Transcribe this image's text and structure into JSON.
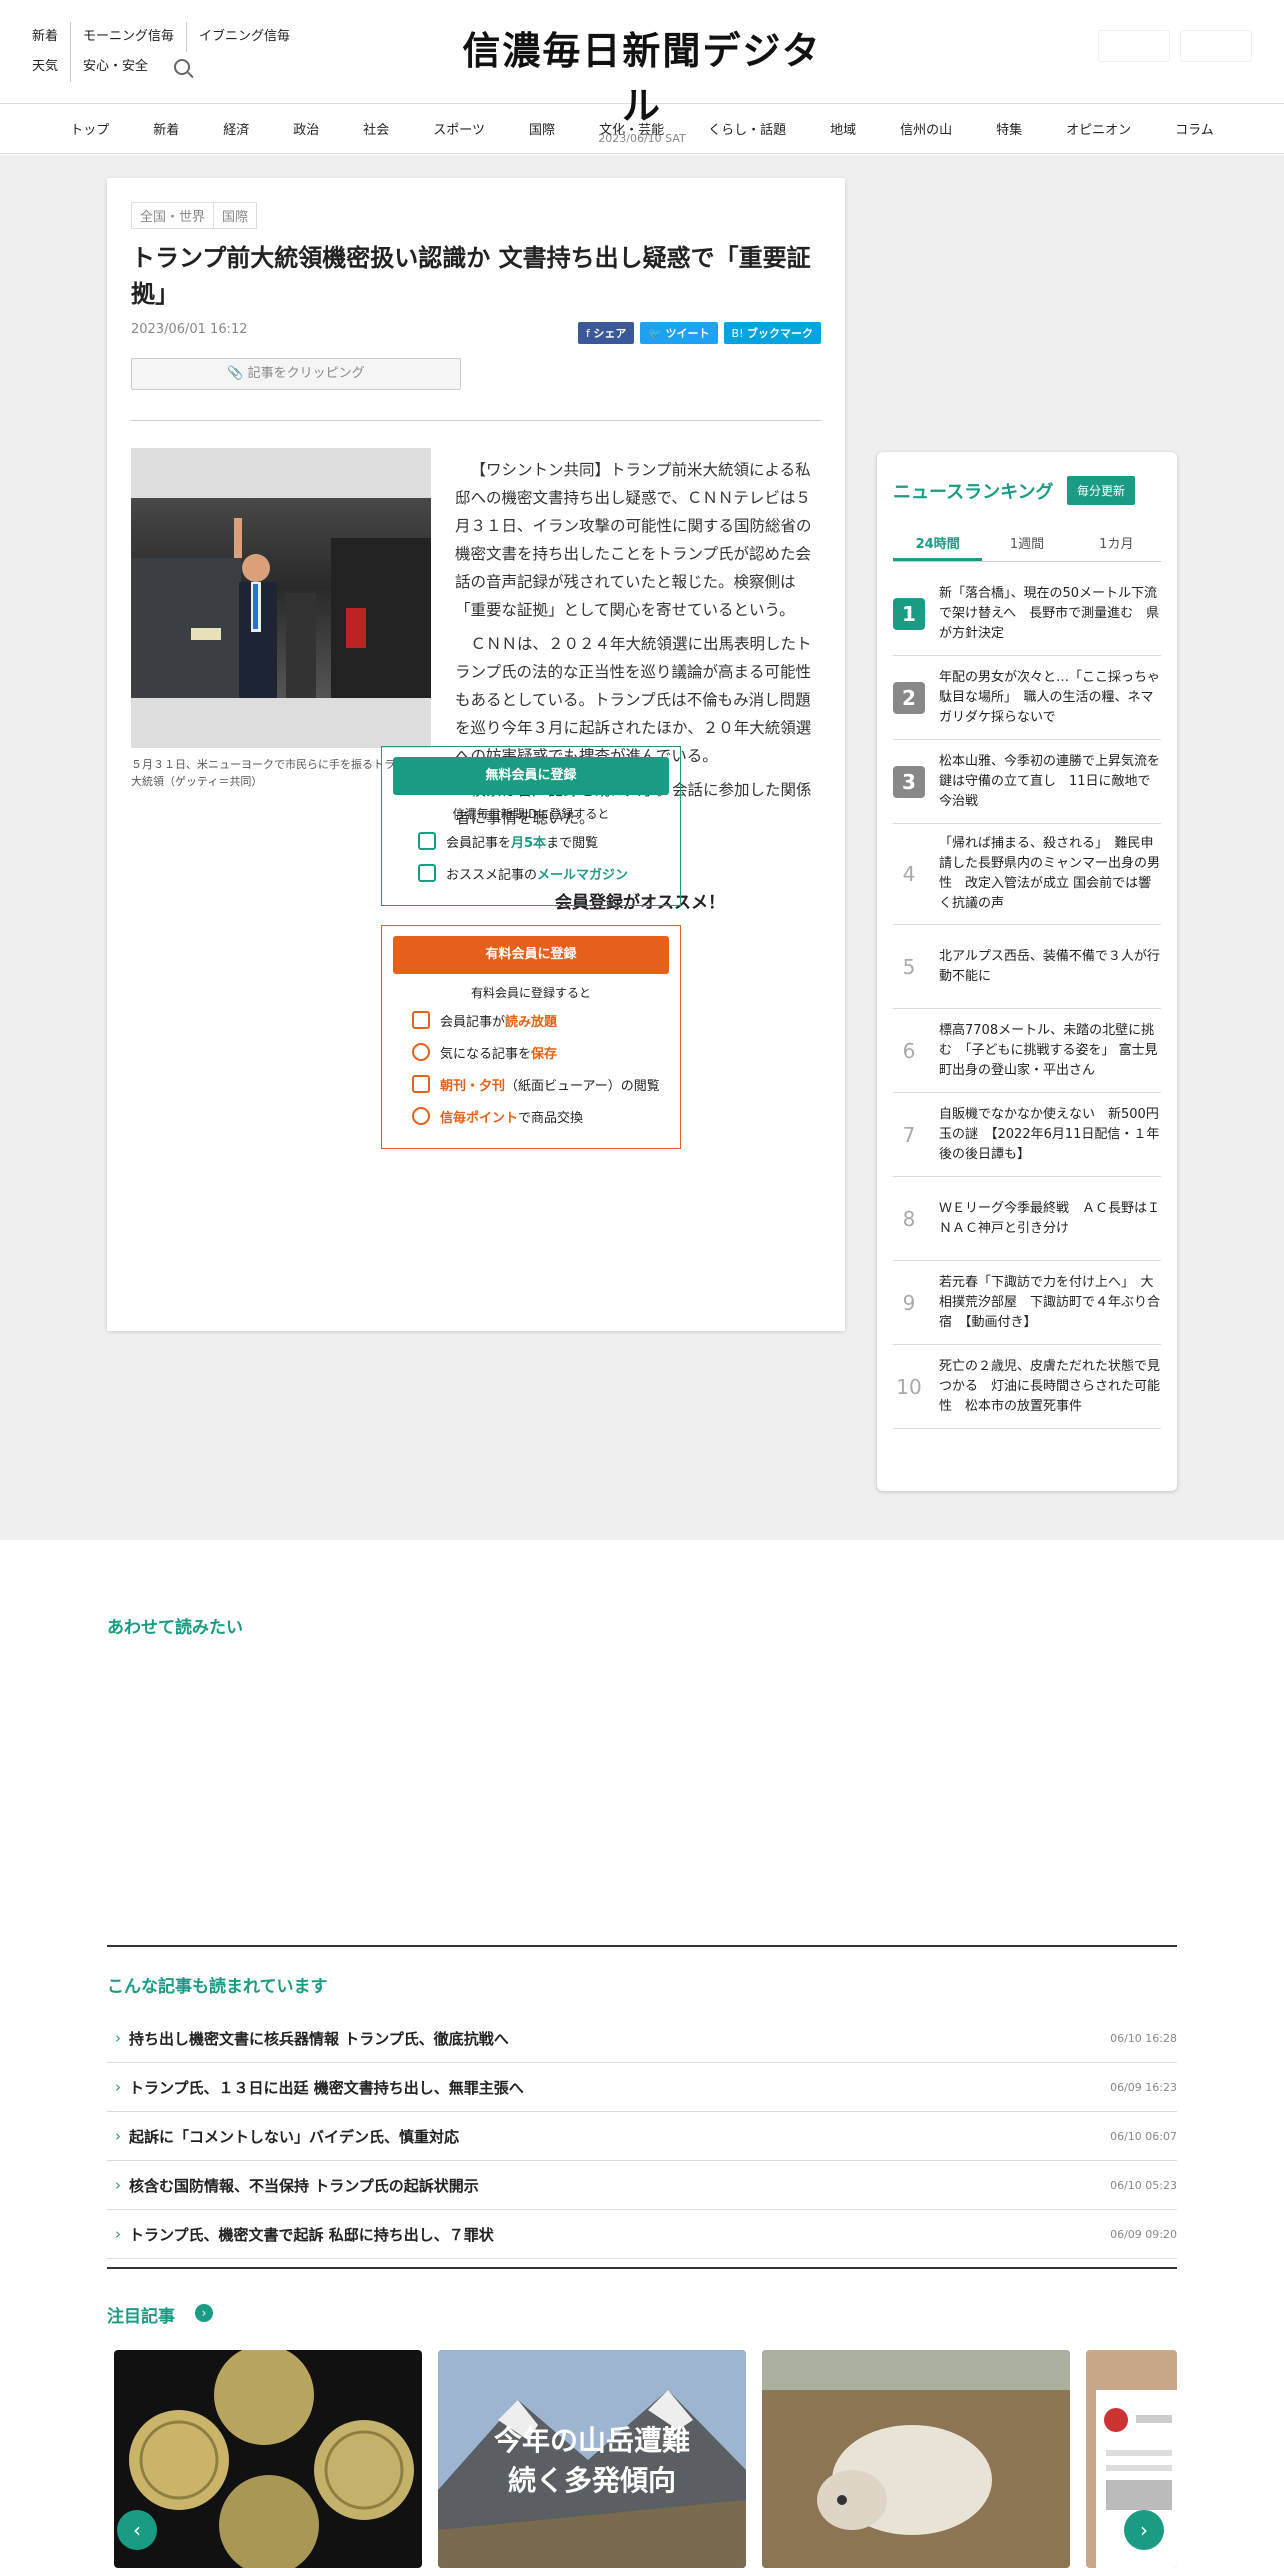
{
  "header": {
    "links_row1": [
      "新着",
      "モーニング信毎",
      "イブニング信毎"
    ],
    "links_row2": [
      "天気",
      "安心・安全"
    ],
    "logo": "信濃毎日新聞デジタル",
    "date": "2023/06/10",
    "weekday": "SAT"
  },
  "nav": [
    "トップ",
    "新着",
    "経済",
    "政治",
    "社会",
    "スポーツ",
    "国際",
    "文化・芸能",
    "くらし・話題",
    "地域",
    "信州の山",
    "特集",
    "オピニオン",
    "コラム"
  ],
  "article": {
    "tags": [
      "全国・世界",
      "国際"
    ],
    "title": "トランプ前大統領機密扱い認識か 文書持ち出し疑惑で「重要証拠」",
    "date": "2023/06/01 16:12",
    "share": [
      "シェア",
      "ツイート",
      "ブックマーク"
    ],
    "clip": "記事をクリッピング",
    "caption": "５月３１日、米ニューヨークで市民らに手を振るトランプ前大統領（ゲッティ＝共同）",
    "paragraphs": [
      "【ワシントン共同】トランプ前米大統領による私邸への機密文書持ち出し疑惑で、ＣＮＮテレビは５月３１日、イラン攻撃の可能性に関する国防総省の機密文書を持ち出したことをトランプ氏が認めた会話の音声記録が残されていたと報じた。検察側は「重要な証拠」として関心を寄せているという。",
      "ＣＮＮは、２０２４年大統領選に出馬表明したトランプ氏の法的な正当性を巡り議論が高まる可能性もあるとしている。トランプ氏は不倫もみ消し問題を巡り今年３月に起訴されたほか、２０年大統領選への妨害疑惑でも捜査が進んでいる。",
      "検察は音声記録を既に入手。会話に参加した関係者に事情を聴いた。"
    ]
  },
  "promo": {
    "title": "会員登録がオススメ！",
    "free_button": "無料会員に登録",
    "free_text": "信濃毎日新聞IDに登録すると",
    "free_items": [
      [
        "会員記事を",
        "月5本",
        "まで閲覧"
      ],
      [
        "おススメ記事の",
        "メールマガジン",
        ""
      ]
    ],
    "paid_button": "有料会員に登録",
    "paid_text": "有料会員に登録すると",
    "paid_items": [
      [
        "会員記事が",
        "読み放題",
        ""
      ],
      [
        "気になる記事を",
        "保存",
        ""
      ],
      [
        "",
        "朝刊・夕刊",
        "（紙面ビューアー）の閲覧"
      ],
      [
        "",
        "信毎ポイント",
        "で商品交換"
      ]
    ],
    "colors": {
      "free": "#1a9b83",
      "paid": "#e56018"
    }
  },
  "ranking": {
    "title": "ニュースランキング",
    "update": "毎分更新",
    "tabs": [
      "24時間",
      "1週間",
      "1カ月"
    ],
    "items": [
      "新「落合橋」、現在の50メートル下流で架け替えへ　長野市で測量進む　県が方針決定",
      "年配の男女が次々と…「ここ採っちゃ駄目な場所」　職人の生活の糧、ネマガリダケ採らないで",
      "松本山雅、今季初の連勝で上昇気流を　鍵は守備の立て直し　11日に敵地で今治戦",
      "「帰れば捕まる、殺される」　難民申請した長野県内のミャンマー出身の男性　改定入管法が成立 国会前では響く抗議の声",
      "北アルプス西岳、装備不備で３人が行動不能に",
      "標高7708メートル、未踏の北壁に挑む　「子どもに挑戦する姿を」 富士見町出身の登山家・平出さん",
      "自販機でなかなか使えない　新500円玉の謎　【2022年6月11日配信・１年後の後日譚も】",
      "ＷＥリーグ今季最終戦　ＡＣ長野はＩＮＡＣ神戸と引き分け",
      "若元春「下諏訪で力を付け上へ」　大相撲荒汐部屋　下諏訪町で４年ぶり合宿　【動画付き】",
      "死亡の２歳児、皮膚ただれた状態で見つかる　灯油に長時間さらされた可能性　松本市の放置死事件"
    ]
  },
  "related_title": "あわせて読みたい",
  "also_read": {
    "title": "こんな記事も読まれています",
    "items": [
      {
        "t": "持ち出し機密文書に核兵器情報 トランプ氏、徹底抗戦へ",
        "d": "06/10 16:28"
      },
      {
        "t": "トランプ氏、１３日に出廷 機密文書持ち出し、無罪主張へ",
        "d": "06/09 16:23"
      },
      {
        "t": "起訴に「コメントしない」バイデン氏、慎重対応",
        "d": "06/10 06:07"
      },
      {
        "t": "核含む国防情報、不当保持 トランプ氏の起訴状開示",
        "d": "06/10 05:23"
      },
      {
        "t": "トランプ氏、機密文書で起訴 私邸に持ち出し、７罪状",
        "d": "06/09 09:20"
      }
    ]
  },
  "featured": {
    "title": "注目記事",
    "card2_text": [
      "今年の山岳遭難",
      "続く多発傾向"
    ]
  }
}
